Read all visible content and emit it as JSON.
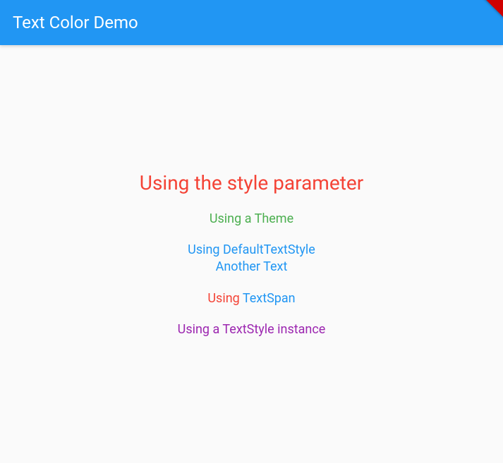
{
  "appbar": {
    "title": "Text Color Demo"
  },
  "content": {
    "style_parameter": "Using the style parameter",
    "theme": "Using a Theme",
    "default_text_style_1": "Using DefaultTextStyle",
    "default_text_style_2": "Another Text",
    "textspan_part1": "Using ",
    "textspan_part2": "TextSpan",
    "textstyle_instance": "Using a TextStyle instance"
  },
  "colors": {
    "primary": "#2196F3",
    "red": "#F44336",
    "green": "#4CAF50",
    "blue": "#2196F3",
    "purple": "#9C27B0"
  }
}
